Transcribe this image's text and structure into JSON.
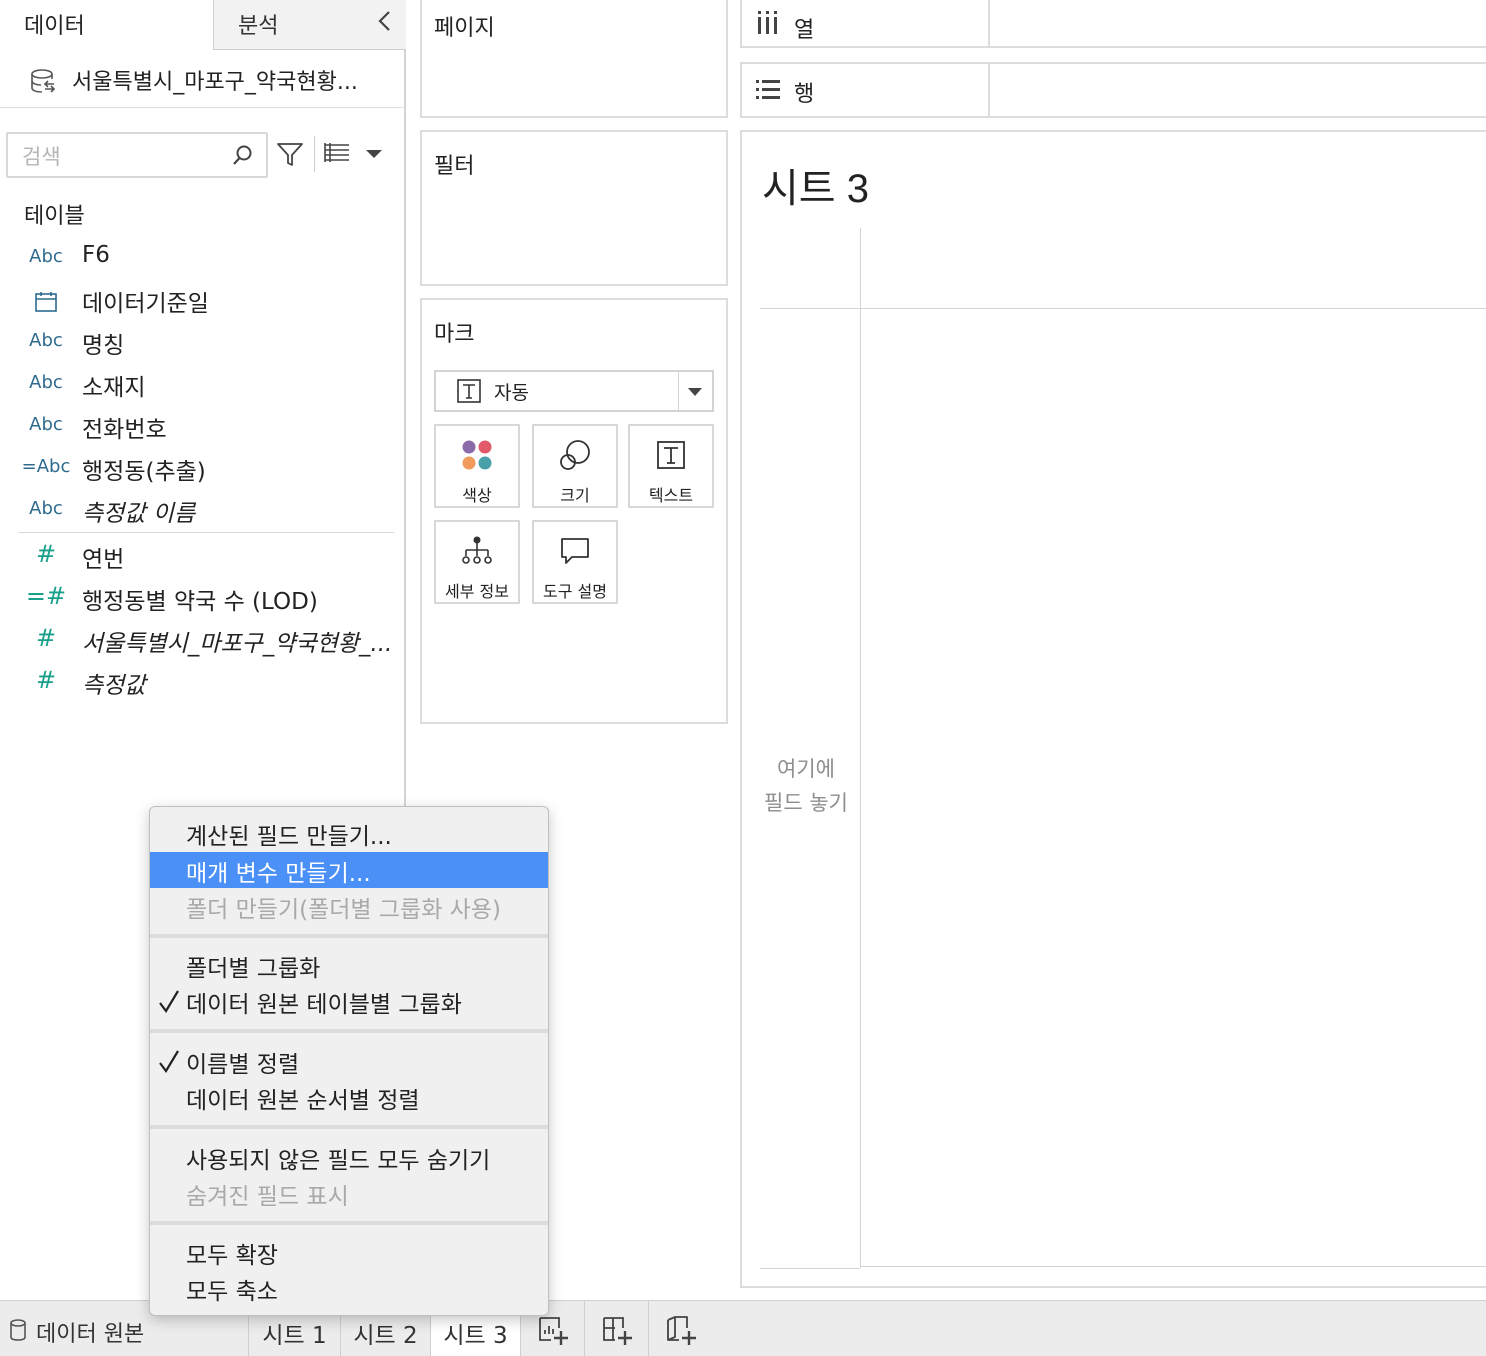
{
  "left_pane": {
    "tab_data": "데이터",
    "tab_analysis": "분석",
    "data_source_name": "서울특별시_마포구_약국현황...",
    "search_placeholder": "검색",
    "tables_header": "테이블",
    "dimensions": [
      {
        "type": "Abc",
        "name": "F6"
      },
      {
        "type": "calendar",
        "name": "데이터기준일"
      },
      {
        "type": "Abc",
        "name": "명칭"
      },
      {
        "type": "Abc",
        "name": "소재지"
      },
      {
        "type": "Abc",
        "name": "전화번호"
      },
      {
        "type": "=Abc",
        "name": "행정동(추출)"
      },
      {
        "type": "Abc",
        "name": "측정값 이름"
      }
    ],
    "measures": [
      {
        "type": "#",
        "name": "연번"
      },
      {
        "type": "=#",
        "name": "행정동별 약국 수 (LOD)"
      },
      {
        "type": "#",
        "name": "서울특별시_마포구_약국현황_..."
      },
      {
        "type": "#",
        "name": "측정값"
      }
    ]
  },
  "shelves": {
    "pages": "페이지",
    "filters": "필터",
    "marks": "마크",
    "columns": "열",
    "rows": "행"
  },
  "marks": {
    "type_label": "자동",
    "buttons": {
      "color": "색상",
      "size": "크기",
      "text": "텍스트",
      "detail": "세부 정보",
      "tooltip": "도구 설명"
    }
  },
  "sheet": {
    "title": "시트 3",
    "drop_hint_line1": "여기에",
    "drop_hint_line2": "필드 놓기"
  },
  "bottom_bar": {
    "data_source_tab": "데이터 원본",
    "sheet_tabs": [
      "시트 1",
      "시트 2",
      "시트 3"
    ],
    "active_tab": "시트 3"
  },
  "context_menu": {
    "items": {
      "create_calc": "계산된 필드 만들기...",
      "create_param": "매개 변수 만들기...",
      "create_folder": "폴더 만들기(폴더별 그룹화 사용)",
      "group_by_folder": "폴더별 그룹화",
      "group_by_table": "데이터 원본 테이블별 그룹화",
      "sort_by_name": "이름별 정렬",
      "sort_by_source": "데이터 원본 순서별 정렬",
      "hide_unused": "사용되지 않은 필드 모두 숨기기",
      "show_hidden": "숨겨진 필드 표시",
      "expand_all": "모두 확장",
      "collapse_all": "모두 축소"
    }
  },
  "colors": {
    "highlight": "#4a90f7",
    "dimension_type": "#2e6b8e",
    "measure_type": "#1aa08a",
    "mark_color_dots": [
      "#8a6aa8",
      "#e05a6a",
      "#f09a5c",
      "#4aa0a8"
    ]
  }
}
